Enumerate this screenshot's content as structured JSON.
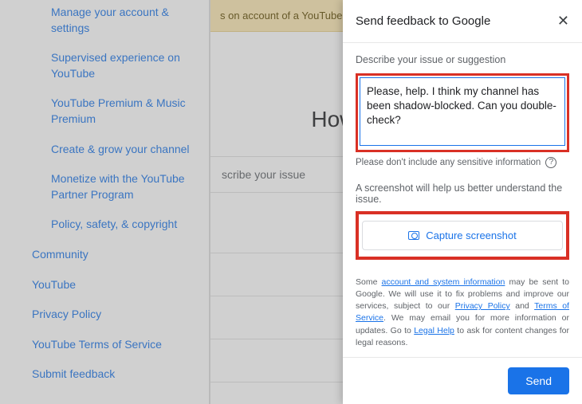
{
  "sidebar": {
    "sub_links": [
      "Manage your account & settings",
      "Supervised experience on YouTube",
      "YouTube Premium & Music Premium",
      "Create & grow your channel",
      "Monetize with the YouTube Partner Program",
      "Policy, safety, & copyright"
    ],
    "top_links": [
      "Community",
      "YouTube",
      "Privacy Policy",
      "YouTube Terms of Service",
      "Submit feedback"
    ]
  },
  "main": {
    "notice": "s on account of a YouTube wide outage. ",
    "help_title": "How can we help ",
    "search_placeholder": "scribe your issue"
  },
  "panel": {
    "title": "Send feedback to Google",
    "describe_label": "Describe your issue or suggestion",
    "textarea_value": "Please, help. I think my channel has been shadow-blocked. Can you double-check?",
    "hint": "Please don't include any sensitive information",
    "screenshot_label": "A screenshot will help us better understand the issue.",
    "capture_label": "Capture screenshot",
    "footer_pre": "Some ",
    "footer_link1": "account and system information",
    "footer_mid1": " may be sent to Google. We will use it to fix problems and improve our services, subject to our ",
    "footer_link2": "Privacy Policy",
    "footer_and": " and ",
    "footer_link3": "Terms of Service",
    "footer_mid2": ". We may email you for more information or updates. Go to ",
    "footer_link4": "Legal Help",
    "footer_end": " to ask for content changes for legal reasons.",
    "send": "Send"
  }
}
